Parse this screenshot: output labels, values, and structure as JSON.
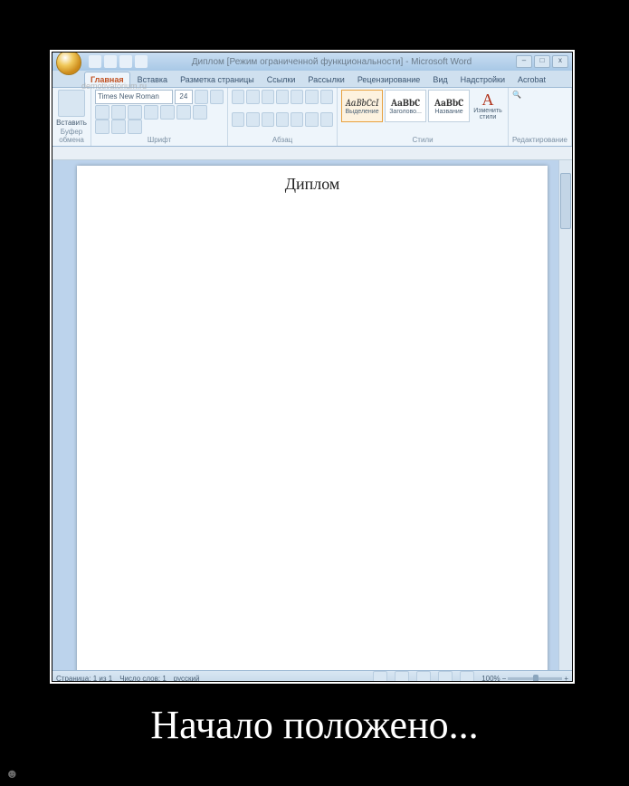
{
  "poster": {
    "caption": "Начало положено...",
    "watermark": "demotivatorium.ru",
    "face_glyph": "☻"
  },
  "window": {
    "title": "Диплом [Режим ограниченной функциональности] - Microsoft Word",
    "qat_icons": [
      "save-icon",
      "undo-icon",
      "redo-icon",
      "refresh-icon"
    ],
    "controls": {
      "min": "–",
      "max": "□",
      "close": "x"
    }
  },
  "tabs": {
    "items": [
      "Главная",
      "Вставка",
      "Разметка страницы",
      "Ссылки",
      "Рассылки",
      "Рецензирование",
      "Вид",
      "Надстройки",
      "Acrobat"
    ],
    "active_index": 0
  },
  "ribbon": {
    "clipboard": {
      "label": "Буфер обмена",
      "paste": "Вставить"
    },
    "font": {
      "label": "Шрифт",
      "name": "Times New Roman",
      "size": "24"
    },
    "paragraph": {
      "label": "Абзац"
    },
    "styles": {
      "label": "Стили",
      "items": [
        {
          "sample": "AaBbCcI",
          "name": "Выделение"
        },
        {
          "sample": "AaBbC",
          "name": "Заголово..."
        },
        {
          "sample": "AaBbC",
          "name": "Название"
        }
      ],
      "change": "Изменить стили"
    },
    "editing": {
      "label": "Редактирование"
    }
  },
  "document": {
    "title": "Диплом"
  },
  "status": {
    "page": "Страница: 1 из 1",
    "words": "Число слов: 1",
    "lang": "русский",
    "zoom": "100%"
  }
}
